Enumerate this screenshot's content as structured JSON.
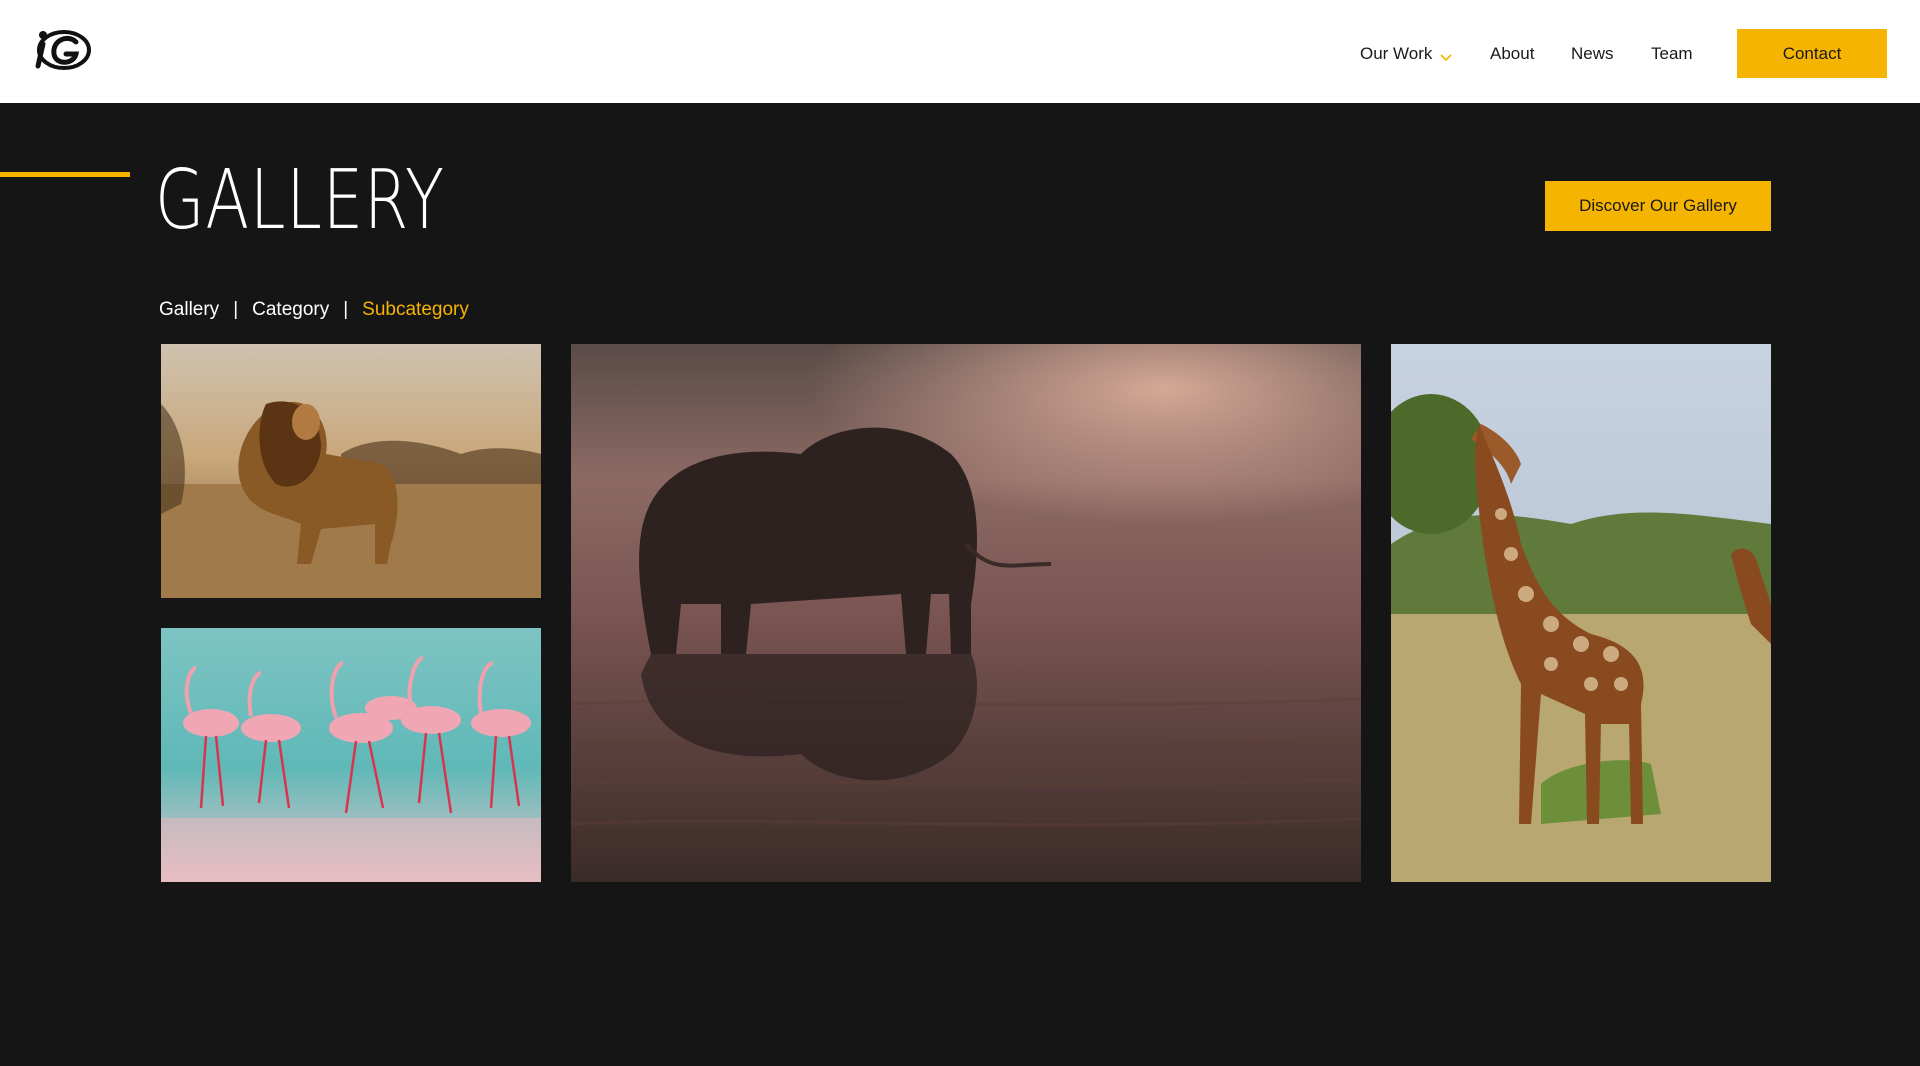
{
  "header": {
    "logo_icon": "ig-logo-icon",
    "nav": {
      "our_work": "Our Work",
      "about": "About",
      "news": "News",
      "team": "Team"
    },
    "contact_label": "Contact"
  },
  "hero": {
    "title": "GALLERY",
    "discover_label": "Discover Our Gallery"
  },
  "breadcrumb": {
    "items": [
      "Gallery",
      "Category",
      "Subcategory"
    ],
    "separator": "|"
  },
  "gallery": {
    "photos": [
      "lion-photo",
      "flamingos-photo",
      "elephant-photo",
      "giraffe-photo"
    ]
  },
  "colors": {
    "accent": "#f5b400",
    "background": "#151515",
    "header_bg": "#ffffff"
  }
}
